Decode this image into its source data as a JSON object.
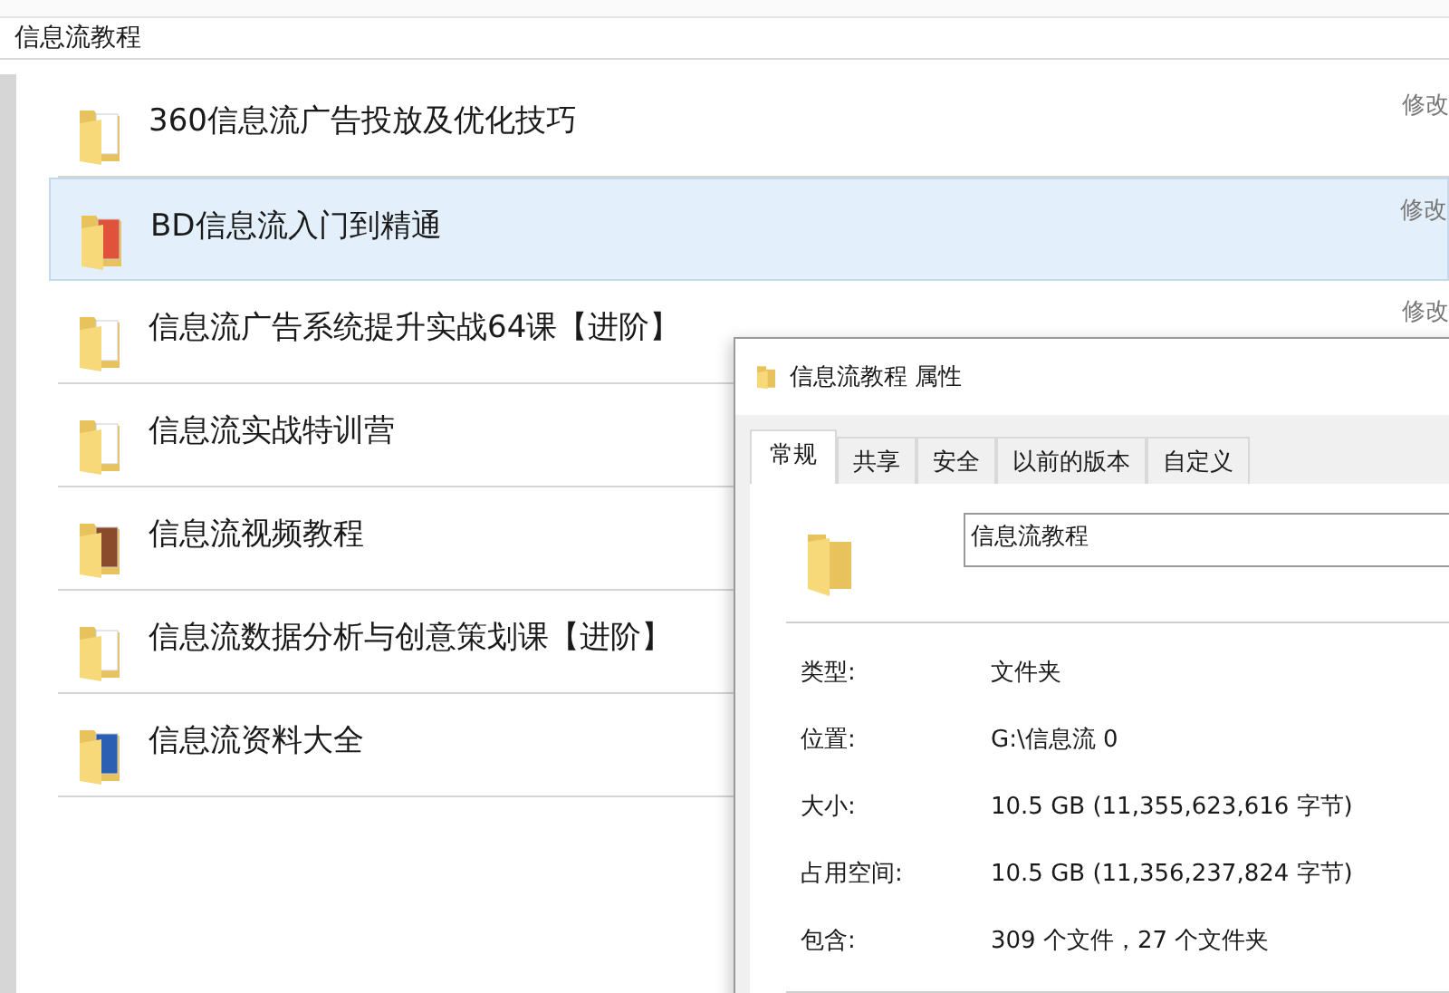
{
  "address_bar": {
    "path": "信息流教程"
  },
  "files": [
    {
      "name": "360信息流广告投放及优化技巧",
      "kind": "paper",
      "selected": false,
      "detail": "修改"
    },
    {
      "name": "BD信息流入门到精通",
      "kind": "red",
      "selected": true,
      "detail": "修改"
    },
    {
      "name": "信息流广告系统提升实战64课【进阶】",
      "kind": "paper",
      "selected": false,
      "detail": "修改"
    },
    {
      "name": "信息流实战特训营",
      "kind": "paper",
      "selected": false
    },
    {
      "name": "信息流视频教程",
      "kind": "brown",
      "selected": false
    },
    {
      "name": "信息流数据分析与创意策划课【进阶】",
      "kind": "paper",
      "selected": false
    },
    {
      "name": "信息流资料大全",
      "kind": "word",
      "selected": false
    }
  ],
  "dialog": {
    "title": "信息流教程 属性",
    "tabs": [
      {
        "label": "常规",
        "selected": true
      },
      {
        "label": "共享",
        "selected": false
      },
      {
        "label": "安全",
        "selected": false
      },
      {
        "label": "以前的版本",
        "selected": false
      },
      {
        "label": "自定义",
        "selected": false
      }
    ],
    "name_field": {
      "value": "信息流教程"
    },
    "properties": [
      {
        "label": "类型:",
        "value": "文件夹"
      },
      {
        "label": "位置:",
        "value": "G:\\信息流 0"
      },
      {
        "label": "大小:",
        "value": "10.5 GB (11,355,623,616 字节)"
      },
      {
        "label": "占用空间:",
        "value": "10.5 GB (11,356,237,824 字节)"
      },
      {
        "label": "包含:",
        "value": "309 个文件，27 个文件夹"
      }
    ]
  }
}
